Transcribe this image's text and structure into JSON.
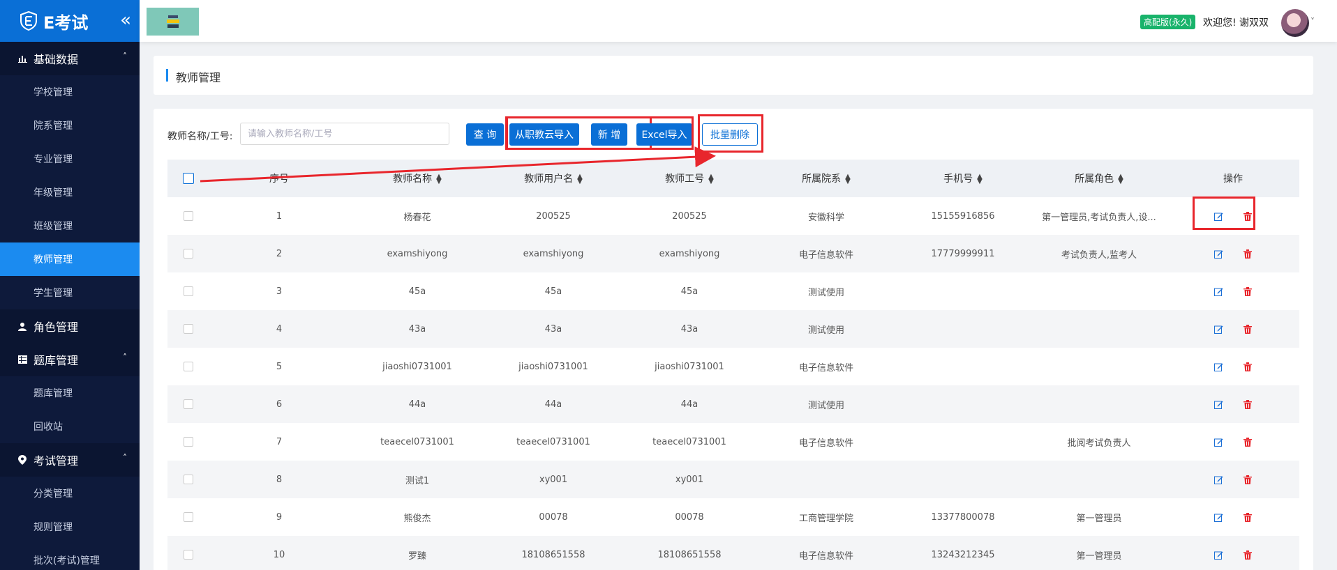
{
  "app": {
    "logo_text": "E考试"
  },
  "sidebar": {
    "groups": [
      {
        "label": "基础数据",
        "items": [
          "学校管理",
          "院系管理",
          "专业管理",
          "年级管理",
          "班级管理",
          "教师管理",
          "学生管理"
        ]
      },
      {
        "label": "角色管理"
      },
      {
        "label": "题库管理",
        "items": [
          "题库管理",
          "回收站"
        ]
      },
      {
        "label": "考试管理",
        "items": [
          "分类管理",
          "规则管理",
          "批次(考试)管理"
        ]
      }
    ],
    "active": "教师管理"
  },
  "header": {
    "badge": "高配版(永久)",
    "welcome": "欢迎您!  谢双双"
  },
  "page": {
    "title": "教师管理"
  },
  "filter": {
    "label": "教师名称/工号:",
    "placeholder": "请输入教师名称/工号",
    "value": ""
  },
  "toolbar": {
    "query": "查 询",
    "import_cloud": "从职教云导入",
    "add": "新 增",
    "excel": "Excel导入",
    "batch_delete": "批量删除"
  },
  "table": {
    "columns": [
      "序号",
      "教师名称",
      "教师用户名",
      "教师工号",
      "所属院系",
      "手机号",
      "所属角色",
      "操作"
    ],
    "rows": [
      [
        "1",
        "杨春花",
        "200525",
        "200525",
        "安徽科学",
        "15155916856",
        "第一管理员,考试负责人,设..."
      ],
      [
        "2",
        "examshiyong",
        "examshiyong",
        "examshiyong",
        "电子信息软件",
        "17779999911",
        "考试负责人,监考人"
      ],
      [
        "3",
        "45a",
        "45a",
        "45a",
        "测试使用",
        "",
        ""
      ],
      [
        "4",
        "43a",
        "43a",
        "43a",
        "测试使用",
        "",
        ""
      ],
      [
        "5",
        "jiaoshi0731001",
        "jiaoshi0731001",
        "jiaoshi0731001",
        "电子信息软件",
        "",
        ""
      ],
      [
        "6",
        "44a",
        "44a",
        "44a",
        "测试使用",
        "",
        ""
      ],
      [
        "7",
        "teaecel0731001",
        "teaecel0731001",
        "teaecel0731001",
        "电子信息软件",
        "",
        "批阅考试负责人"
      ],
      [
        "8",
        "测试1",
        "xy001",
        "xy001",
        "",
        "",
        ""
      ],
      [
        "9",
        "熊俊杰",
        "00078",
        "00078",
        "工商管理学院",
        "13377800078",
        "第一管理员"
      ],
      [
        "10",
        "罗臻",
        "18108651558",
        "18108651558",
        "电子信息软件",
        "13243212345",
        "第一管理员"
      ]
    ]
  },
  "colors": {
    "primary": "#0a6fd6",
    "sidebar": "#0e1a3b",
    "active": "#1b8bf0",
    "danger": "#e8262c",
    "badge": "#19b36b"
  }
}
